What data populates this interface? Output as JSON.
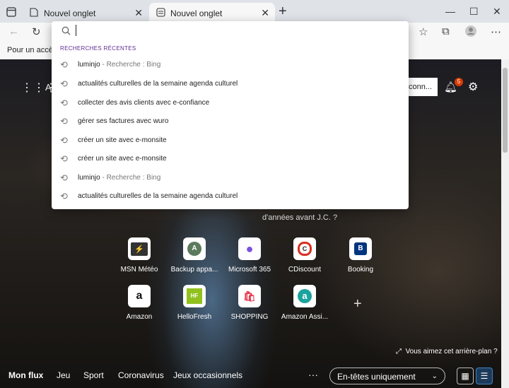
{
  "tabs": [
    {
      "title": "Nouvel onglet"
    },
    {
      "title": "Nouvel onglet"
    }
  ],
  "favorites_bar": {
    "label": "Pour un accès ra"
  },
  "ntp": {
    "apps_letter": "A",
    "connect_label": "conn...",
    "notification_count": "5",
    "caption": "d'années avant J.C. ?",
    "background_question": "Vous aimez cet arrière-plan ?",
    "quick_links": [
      {
        "name": "MSN Météo",
        "glyph": "⚡"
      },
      {
        "name": "Backup appa...",
        "glyph": "A"
      },
      {
        "name": "Microsoft 365",
        "glyph": "●"
      },
      {
        "name": "CDiscount",
        "glyph": "C"
      },
      {
        "name": "Booking",
        "glyph": "B"
      },
      {
        "name": "Amazon",
        "glyph": "a"
      },
      {
        "name": "HelloFresh",
        "glyph": "HF"
      },
      {
        "name": "SHOPPING",
        "glyph": "🛍"
      },
      {
        "name": "Amazon Assi...",
        "glyph": "a"
      }
    ],
    "add_glyph": "+",
    "bottom_nav": [
      "Mon flux",
      "Jeu",
      "Sport",
      "Coronavirus",
      "Jeux occasionnels"
    ],
    "more_glyph": "···",
    "feed_select": "En-têtes uniquement"
  },
  "search": {
    "value": "",
    "placeholder": "",
    "section_label": "RECHERCHES RÉCENTES",
    "items": [
      {
        "text": "luminjo",
        "sub": "- Recherche : Bing"
      },
      {
        "text": "actualités culturelles de la semaine agenda culturel",
        "sub": ""
      },
      {
        "text": "collecter des avis clients avec e-confiance",
        "sub": ""
      },
      {
        "text": "gérer ses factures avec wuro",
        "sub": ""
      },
      {
        "text": "créer un site avec e-monsite",
        "sub": ""
      },
      {
        "text": "créer un site avec e-monsite",
        "sub": ""
      },
      {
        "text": "luminjo",
        "sub": "- Recherche : Bing"
      },
      {
        "text": "actualités culturelles de la semaine agenda culturel",
        "sub": ""
      }
    ]
  }
}
